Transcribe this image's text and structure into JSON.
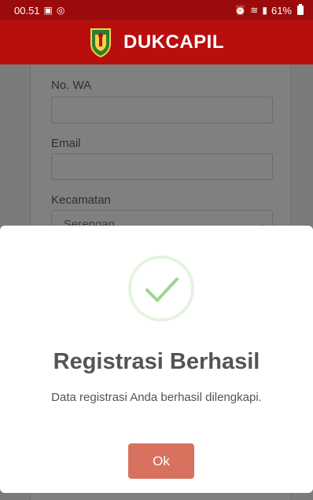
{
  "status_bar": {
    "time": "00.51",
    "gallery_icon": "image-icon",
    "whatsapp_icon": "whatsapp-icon",
    "alarm_icon": "alarm-icon",
    "wifi_icon": "wifi-icon",
    "signal_icon": "signal-icon",
    "battery": "61%"
  },
  "header": {
    "title": "DUKCAPIL",
    "logo_icon": "coat-of-arms-logo"
  },
  "form": {
    "wa_label": "No. WA",
    "wa_value": "",
    "email_label": "Email",
    "email_value": "",
    "kecamatan_label": "Kecamatan",
    "kecamatan_value": "Serengan"
  },
  "modal": {
    "icon": "check-icon",
    "title": "Registrasi Berhasil",
    "message": "Data registrasi Anda berhasil dilengkapi.",
    "ok_label": "Ok"
  },
  "colors": {
    "header_bg": "#b90e0e",
    "status_bg": "#9c0b0b",
    "ok_button": "#d9715f",
    "success_green": "#9bd68c"
  }
}
